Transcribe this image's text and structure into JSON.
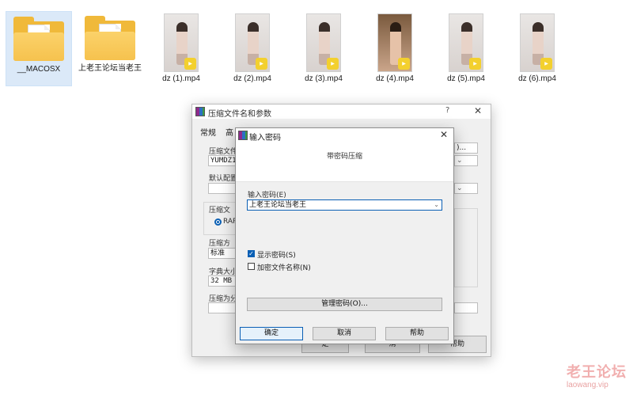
{
  "files": [
    {
      "name": "__MACOSX",
      "type": "folder",
      "selected": true
    },
    {
      "name": "上老王论坛当老王",
      "type": "folder",
      "selected": false
    },
    {
      "name": "dz (1).mp4",
      "type": "video"
    },
    {
      "name": "dz (2).mp4",
      "type": "video"
    },
    {
      "name": "dz (3).mp4",
      "type": "video"
    },
    {
      "name": "dz (4).mp4",
      "type": "video"
    },
    {
      "name": "dz (5).mp4",
      "type": "video"
    },
    {
      "name": "dz (6).mp4",
      "type": "video"
    }
  ],
  "back_dialog": {
    "title": "压缩文件名和参数",
    "help": "?",
    "close": "✕",
    "tab_general": "常规",
    "tab_advanced": "高",
    "archive_name_label": "压缩文件",
    "archive_name_value": "YUMDZ1.",
    "browse": ")...",
    "default_config_label": "默认配置",
    "format_group_label": "压缩文",
    "format_rar": "RAR",
    "method_label": "压缩方",
    "method_value": "标准",
    "dict_label": "字典大小",
    "dict_value": "32 MB",
    "split_label": "压缩为分",
    "ok_partial": "定",
    "cancel_partial": "消",
    "help_btn": "帮助"
  },
  "password_dialog": {
    "title": "输入密码",
    "close": "✕",
    "header": "带密码压缩",
    "password_label": "输入密码(E)",
    "password_value": "上老王论坛当老王",
    "show_password": "显示密码(S)",
    "show_password_checked": true,
    "encrypt_names": "加密文件名称(N)",
    "encrypt_names_checked": false,
    "manage_button": "管理密码(O)...",
    "ok_button": "确定",
    "cancel_button": "取消",
    "help_button": "帮助"
  },
  "watermark": {
    "line1": "老王论坛",
    "line2": "laowang.vip"
  },
  "icons": {
    "folder": "folder-icon",
    "video": "video-thumbnail",
    "player_badge": "player-badge-icon",
    "app": "winrar-icon",
    "dropdown": "chevron-down-icon"
  },
  "colors": {
    "accent": "#0a5fb4",
    "folder": "#f6c24e",
    "watermark": "#f0a7a7"
  }
}
